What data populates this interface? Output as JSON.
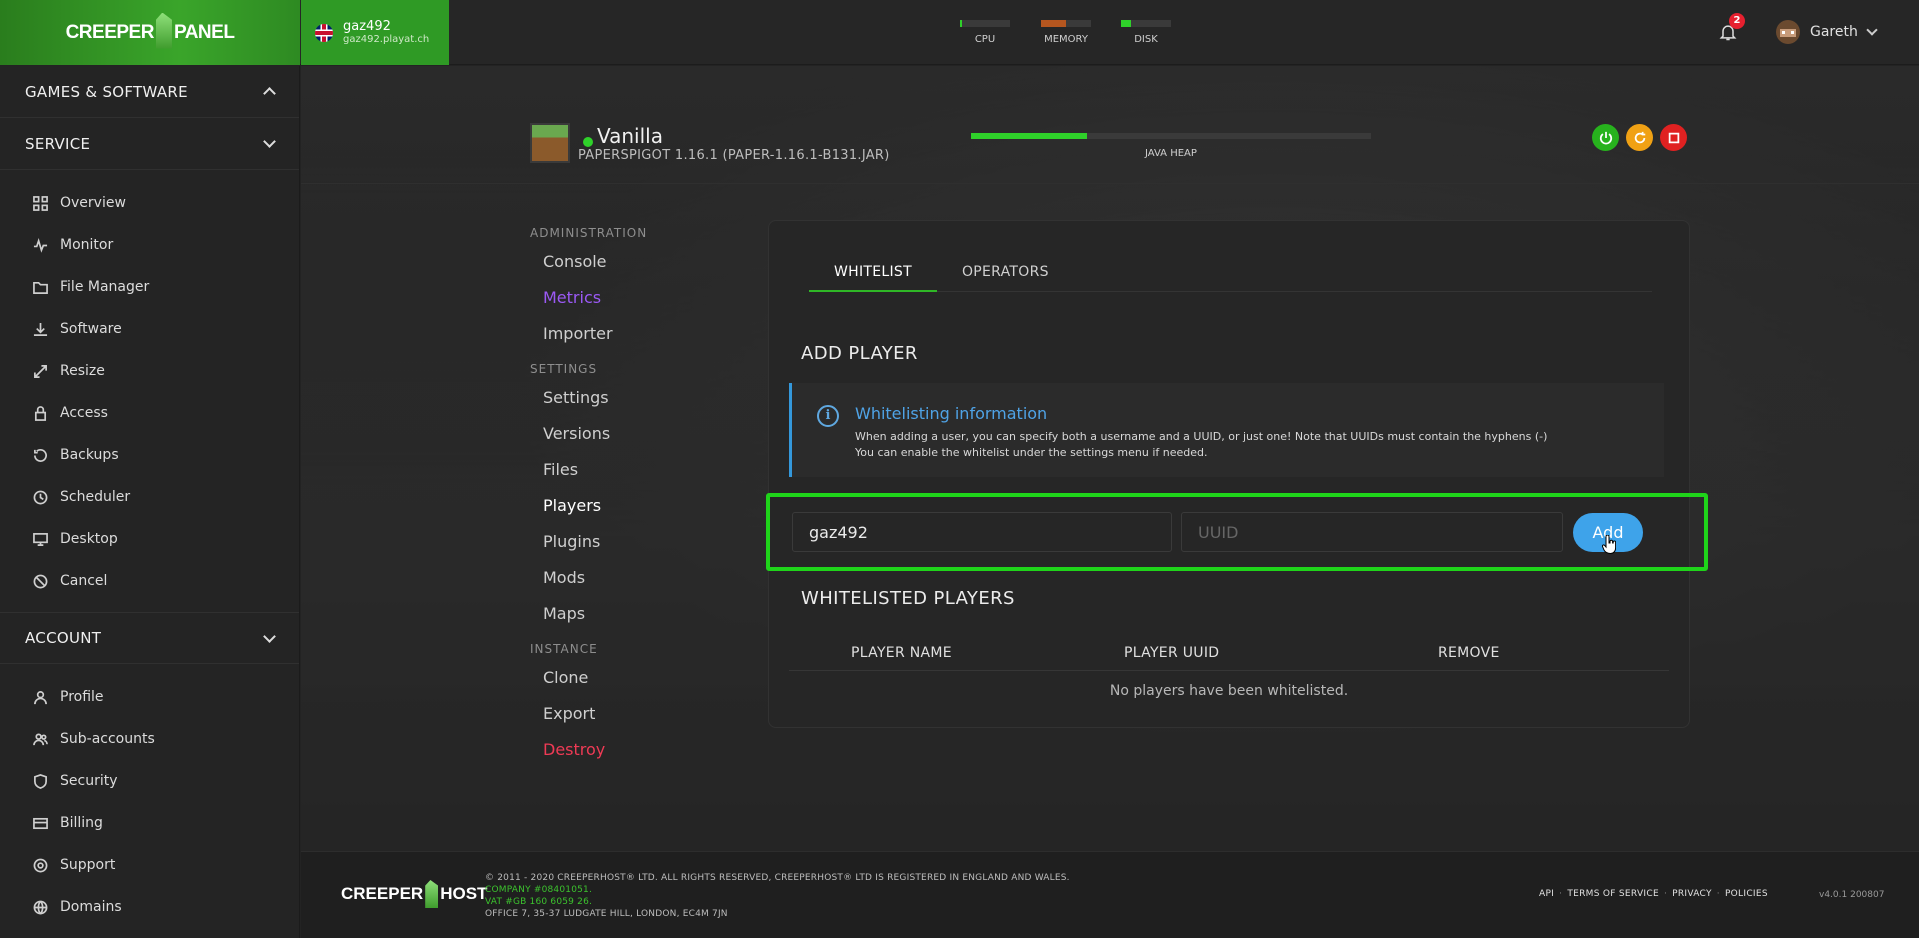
{
  "brand": {
    "logo_left": "CREEPER",
    "logo_right": "PANEL"
  },
  "server_chip": {
    "name": "gaz492",
    "host": "gaz492.playat.ch"
  },
  "meters": [
    {
      "label": "CPU",
      "percent": 3,
      "color": "#2fd12a"
    },
    {
      "label": "MEMORY",
      "percent": 50,
      "color": "#b5561f"
    },
    {
      "label": "DISK",
      "percent": 20,
      "color": "#2fd12a"
    }
  ],
  "notifications": {
    "count": "2"
  },
  "user": {
    "name": "Gareth"
  },
  "sidebar": {
    "sections": [
      {
        "title": "GAMES & SOFTWARE",
        "expanded": true
      },
      {
        "title": "SERVICE",
        "expanded": false
      },
      {
        "title": "ACCOUNT",
        "expanded": false
      }
    ],
    "service_items": [
      {
        "label": "Overview",
        "icon": "grid-icon"
      },
      {
        "label": "Monitor",
        "icon": "pulse-icon"
      },
      {
        "label": "File Manager",
        "icon": "folder-icon"
      },
      {
        "label": "Software",
        "icon": "download-icon"
      },
      {
        "label": "Resize",
        "icon": "resize-icon"
      },
      {
        "label": "Access",
        "icon": "lock-icon"
      },
      {
        "label": "Backups",
        "icon": "history-icon"
      },
      {
        "label": "Scheduler",
        "icon": "clock-icon"
      },
      {
        "label": "Desktop",
        "icon": "monitor-icon"
      },
      {
        "label": "Cancel",
        "icon": "cancel-icon"
      }
    ],
    "account_items": [
      {
        "label": "Profile",
        "icon": "user-icon"
      },
      {
        "label": "Sub-accounts",
        "icon": "users-icon"
      },
      {
        "label": "Security",
        "icon": "shield-icon"
      },
      {
        "label": "Billing",
        "icon": "card-icon"
      },
      {
        "label": "Support",
        "icon": "lifebuoy-icon"
      },
      {
        "label": "Domains",
        "icon": "globe-icon"
      }
    ]
  },
  "server": {
    "title": "Vanilla",
    "subtitle": "PAPERSPIGOT 1.16.1 (PAPER-1.16.1-B131.JAR)",
    "java_heap_label": "JAVA HEAP",
    "java_heap_percent": 29,
    "status": "online"
  },
  "subnav": {
    "administration": {
      "title": "ADMINISTRATION",
      "items": [
        "Console",
        "Metrics",
        "Importer"
      ]
    },
    "settings": {
      "title": "SETTINGS",
      "items": [
        "Settings",
        "Versions",
        "Files",
        "Players",
        "Plugins",
        "Mods",
        "Maps"
      ]
    },
    "instance": {
      "title": "INSTANCE",
      "items": [
        "Clone",
        "Export",
        "Destroy"
      ]
    },
    "active": "Players"
  },
  "panel": {
    "tabs": [
      "WHITELIST",
      "OPERATORS"
    ],
    "active_tab": "WHITELIST",
    "add_heading": "ADD PLAYER",
    "info": {
      "title": "Whitelisting information",
      "line1": "When adding a user, you can specify both a username and a UUID, or just one! Note that UUIDs must contain the hyphens (-)",
      "line2": "You can enable the whitelist under the settings menu if needed."
    },
    "username_value": "gaz492",
    "uuid_placeholder": "UUID",
    "add_label": "Add",
    "list_heading": "WHITELISTED PLAYERS",
    "columns": [
      "PLAYER NAME",
      "PLAYER UUID",
      "REMOVE"
    ],
    "empty_text": "No players have been whitelisted."
  },
  "footer": {
    "logo_left": "CREEPER",
    "logo_right": "HOST",
    "line1": "© 2011 - 2020 CREEPERHOST® LTD. ALL RIGHTS RESERVED, CREEPERHOST® LTD IS REGISTERED IN ENGLAND AND WALES.",
    "line2": "COMPANY #08401051.",
    "line3": "VAT #GB 160 6059 26.",
    "line4": "OFFICE 7, 35-37 LUDGATE HILL, LONDON, EC4M 7JN",
    "links": [
      "API",
      "TERMS OF SERVICE",
      "PRIVACY",
      "POLICIES"
    ],
    "version": "v4.0.1 200807"
  }
}
